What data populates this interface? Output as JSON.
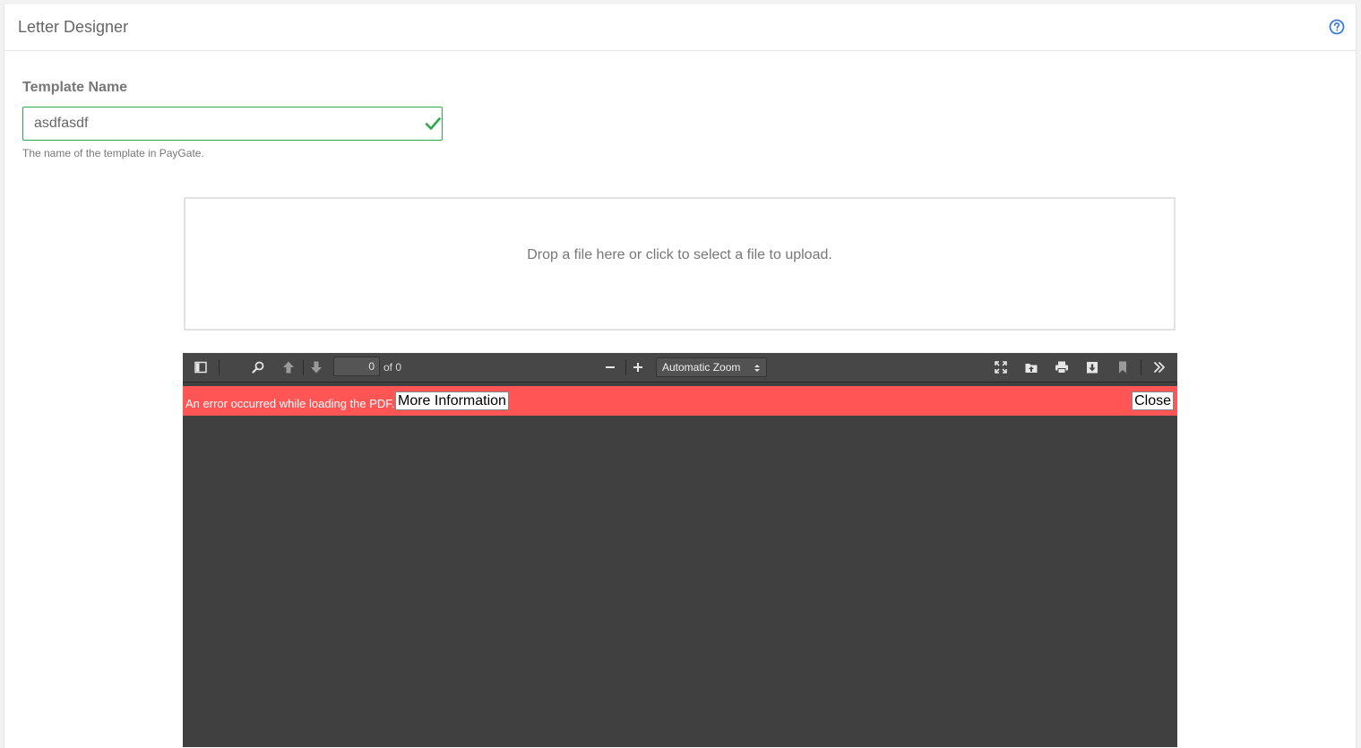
{
  "header": {
    "title": "Letter Designer",
    "help_icon": "question-circle-icon",
    "accent": "#3b7dd8"
  },
  "form": {
    "template_name_label": "Template Name",
    "template_name_value": "asdfasdf",
    "template_name_help": "The name of the template in PayGate.",
    "valid_icon": "checkmark-icon",
    "valid_color": "#2ea84a"
  },
  "dropzone": {
    "text": "Drop a file here or click to select a file to upload."
  },
  "pdf_viewer": {
    "toolbar": {
      "page_number": "0",
      "page_count_text": "of 0",
      "zoom": "Automatic Zoom",
      "icons": [
        "sidebar-toggle-icon",
        "search-icon",
        "previous-page-icon",
        "next-page-icon",
        "zoom-out-icon",
        "zoom-in-icon",
        "presentation-mode-icon",
        "open-file-icon",
        "print-icon",
        "download-icon",
        "bookmark-icon",
        "tools-icon"
      ]
    },
    "error": {
      "message": "An error occurred while loading the PDF.",
      "more_info_label": "More Information",
      "close_label": "Close",
      "color": "#ff5555"
    }
  }
}
